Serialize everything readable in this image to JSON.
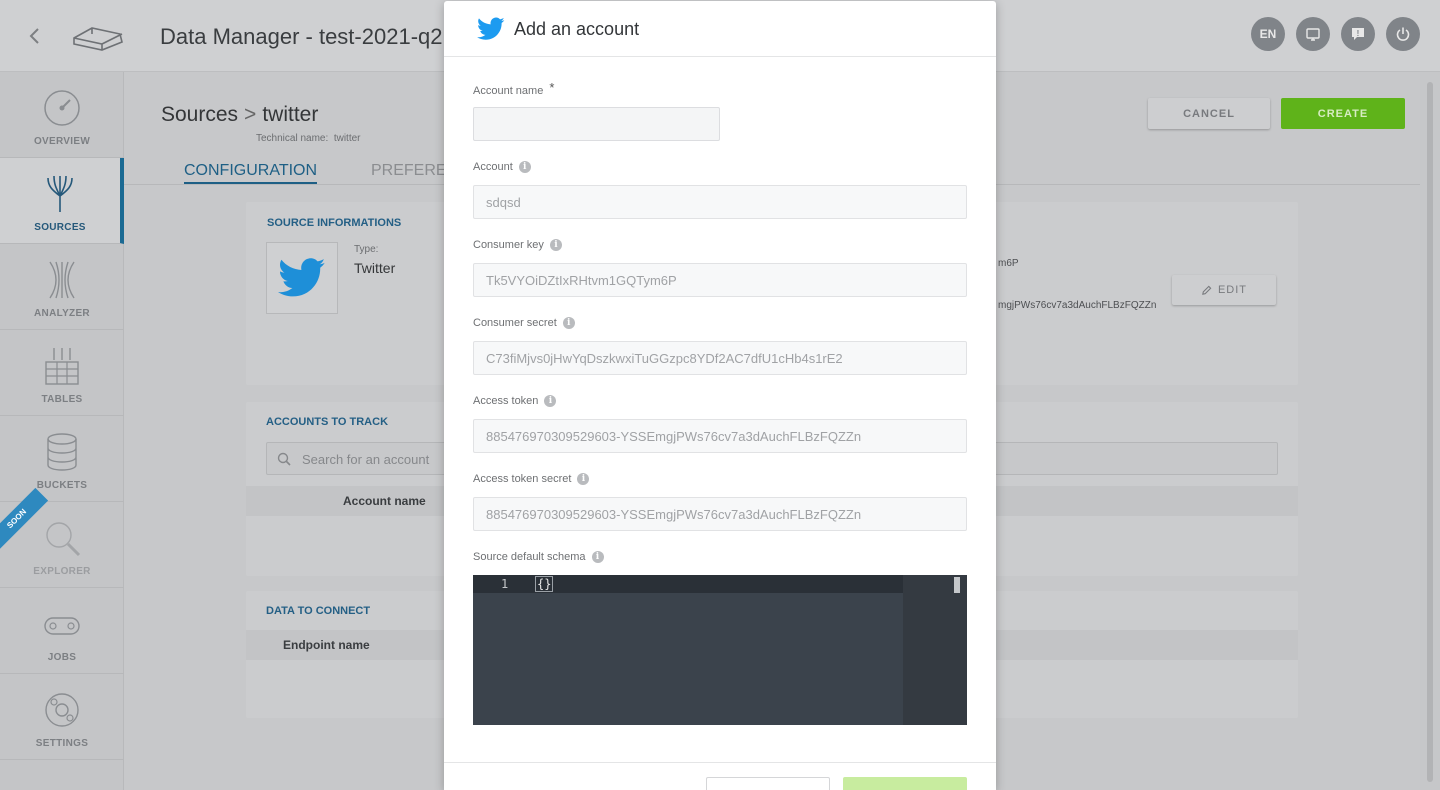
{
  "header": {
    "title": "Data Manager - test-2021-q2",
    "lang": "EN"
  },
  "sidebar": {
    "items": [
      {
        "label": "OVERVIEW",
        "icon": "speedometer-icon"
      },
      {
        "label": "SOURCES",
        "icon": "sources-icon"
      },
      {
        "label": "ANALYZER",
        "icon": "analyzer-icon"
      },
      {
        "label": "TABLES",
        "icon": "tables-icon"
      },
      {
        "label": "BUCKETS",
        "icon": "buckets-icon"
      },
      {
        "label": "EXPLORER",
        "icon": "explorer-icon"
      },
      {
        "label": "JOBS",
        "icon": "jobs-icon"
      },
      {
        "label": "SETTINGS",
        "icon": "settings-icon"
      }
    ],
    "active": "SOURCES",
    "soon_ribbon": "SOON"
  },
  "page": {
    "breadcrumb_root": "Sources",
    "breadcrumb_sep": ">",
    "breadcrumb_current": "twitter",
    "technical_name_label": "Technical name:",
    "technical_name": "twitter",
    "tabs": [
      "CONFIGURATION",
      "PREFERENCES"
    ],
    "tab_pref_visible": "PREFEREN",
    "cancel_label": "CANCEL",
    "create_label": "CREATE"
  },
  "source_info": {
    "title": "SOURCE INFORMATIONS",
    "type_label": "Type:",
    "type_value": "Twitter",
    "trunc_1": "m6P",
    "trunc_2": "mgjPWs76cv7a3dAuchFLBzFQZZn",
    "edit_label": "EDIT"
  },
  "accounts": {
    "title": "ACCOUNTS TO TRACK",
    "search_placeholder": "Search for an account",
    "col_account_name": "Account name"
  },
  "data_connect": {
    "title": "DATA TO CONNECT",
    "col_endpoint_name": "Endpoint name"
  },
  "modal": {
    "title": "Add an account",
    "fields": {
      "account_name": {
        "label": "Account name",
        "required": "*",
        "value": ""
      },
      "account": {
        "label": "Account",
        "value": "sdqsd"
      },
      "consumer_key": {
        "label": "Consumer key",
        "value": "Tk5VYOiDZtIxRHtvm1GQTym6P"
      },
      "consumer_secret": {
        "label": "Consumer secret",
        "value": "C73fiMjvs0jHwYqDszkwxiTuGGzpc8YDf2AC7dfU1cHb4s1rE2"
      },
      "access_token": {
        "label": "Access token",
        "value": "885476970309529603-YSSEmgjPWs76cv7a3dAuchFLBzFQZZn"
      },
      "access_token_secret": {
        "label": "Access token secret",
        "value": "885476970309529603-YSSEmgjPWs76cv7a3dAuchFLBzFQZZn"
      },
      "source_default_schema": {
        "label": "Source default schema",
        "line_number": "1",
        "code": "{}"
      }
    }
  },
  "colors": {
    "brand_blue": "#1d9bf0",
    "active_nav": "#1b6a93",
    "create_green": "#6cc51f",
    "editor_bg": "#3b434c"
  }
}
